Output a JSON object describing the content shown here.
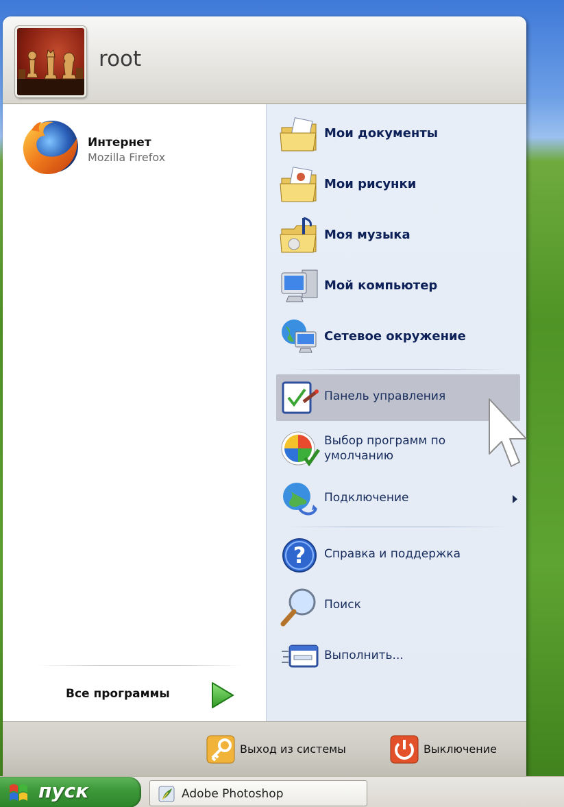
{
  "user": {
    "name": "root"
  },
  "pinned": [
    {
      "title": "Интернет",
      "subtitle": "Mozilla Firefox",
      "icon": "firefox-icon"
    }
  ],
  "all_programs": {
    "label": "Все программы",
    "icon": "green-arrow-icon"
  },
  "places": [
    {
      "label": "Мои документы",
      "icon": "my-documents-icon"
    },
    {
      "label": "Мои рисунки",
      "icon": "my-pictures-icon"
    },
    {
      "label": "Моя музыка",
      "icon": "my-music-icon"
    },
    {
      "label": "Мой компьютер",
      "icon": "my-computer-icon"
    },
    {
      "label": "Сетевое окружение",
      "icon": "network-places-icon"
    }
  ],
  "system": [
    {
      "label": "Панель управления",
      "icon": "control-panel-icon",
      "highlighted": true
    },
    {
      "label": "Выбор программ по умолчанию",
      "icon": "default-programs-icon"
    },
    {
      "label": "Подключение",
      "icon": "connect-to-icon",
      "submenu": true
    }
  ],
  "tools": [
    {
      "label": "Справка и поддержка",
      "icon": "help-icon"
    },
    {
      "label": "Поиск",
      "icon": "search-icon"
    },
    {
      "label": "Выполнить...",
      "icon": "run-icon"
    }
  ],
  "footer": {
    "logoff_label": "Выход из системы",
    "shutdown_label": "Выключение"
  },
  "taskbar": {
    "start_label": "пуск",
    "task_label": "Adobe Photoshop"
  },
  "colors": {
    "hover_bg": "#bfc2cc",
    "right_pane_bg": "#e6ecf6",
    "start_green": "#3f9a3b",
    "place_text": "#0d2158"
  }
}
